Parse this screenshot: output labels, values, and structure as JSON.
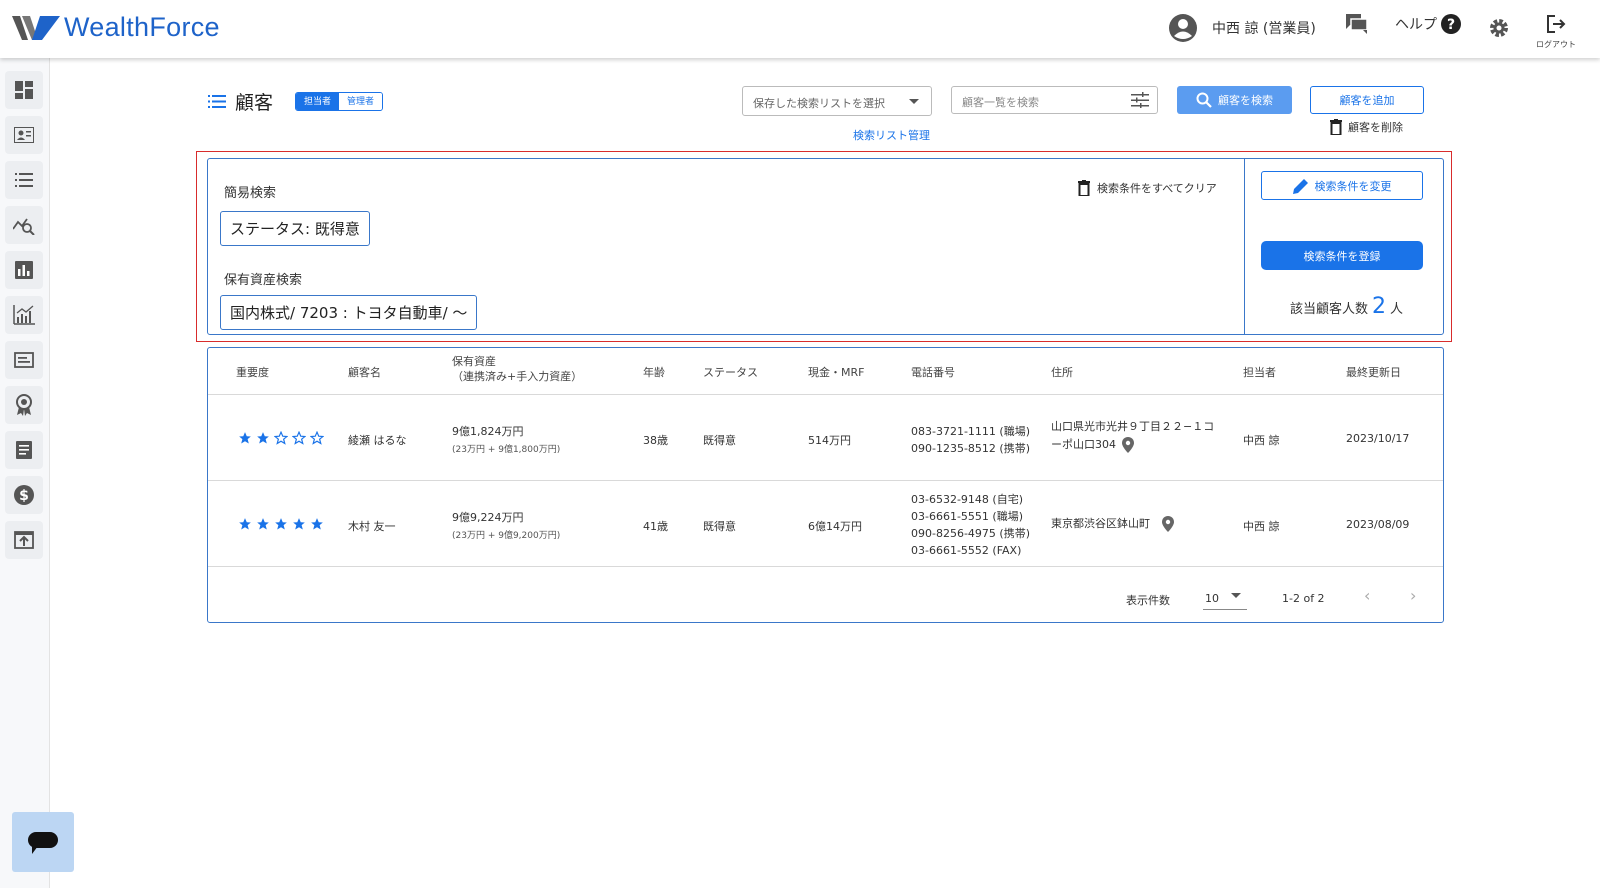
{
  "app": {
    "brand": "WealthForce"
  },
  "header": {
    "user_name": "中西 諒 (営業員)",
    "help_label": "ヘルプ",
    "logout_label": "ログアウト"
  },
  "sidebar": {
    "items": [
      {
        "icon": "dashboard-icon"
      },
      {
        "icon": "contact-card-icon"
      },
      {
        "icon": "list-icon"
      },
      {
        "icon": "analytics-search-icon"
      },
      {
        "icon": "bar-chart-icon"
      },
      {
        "icon": "chart-growth-icon"
      },
      {
        "icon": "card-icon"
      },
      {
        "icon": "award-icon"
      },
      {
        "icon": "document-icon"
      },
      {
        "icon": "dollar-icon"
      },
      {
        "icon": "upload-icon"
      }
    ]
  },
  "page": {
    "title": "顧客",
    "role_tabs": [
      "担当者",
      "管理者"
    ],
    "saved_list_placeholder": "保存した検索リストを選択",
    "saved_list_manage": "検索リスト管理",
    "search_placeholder": "顧客一覧を検索",
    "search_button": "顧客を検索",
    "add_button": "顧客を追加",
    "delete_button": "顧客を削除"
  },
  "search_panel": {
    "simple_label": "簡易検索",
    "status_chip": "ステータス: 既得意",
    "asset_label": "保有資産検索",
    "asset_chip": "国内株式/ 7203 : トヨタ自動車/ 〜",
    "clear_all": "検索条件をすべてクリア",
    "edit_button": "検索条件を変更",
    "register_button": "検索条件を登録",
    "count_label": "該当顧客人数",
    "count_value": "2",
    "count_unit": "人"
  },
  "table": {
    "headers": {
      "importance": "重要度",
      "name": "顧客名",
      "assets": "保有資産",
      "assets_sub": "（連携済み+手入力資産）",
      "age": "年齢",
      "status": "ステータス",
      "cash": "現金・MRF",
      "phone": "電話番号",
      "address": "住所",
      "owner": "担当者",
      "updated": "最終更新日"
    },
    "rows": [
      {
        "stars": 2,
        "name": "綾瀬 はるな",
        "assets": "9億1,824万円",
        "assets_sub": "(23万円 + 9億1,800万円)",
        "age": "38歳",
        "status": "既得意",
        "cash": "514万円",
        "phone1": "083-3721-1111 (職場)",
        "phone2": "090-1235-8512 (携帯)",
        "address1": "山口県光市光井９丁目２２−１コ",
        "address2": "ーポ山口304",
        "owner": "中西 諒",
        "updated": "2023/10/17"
      },
      {
        "stars": 5,
        "name": "木村 友一",
        "assets": "9億9,224万円",
        "assets_sub": "(23万円 + 9億9,200万円)",
        "age": "41歳",
        "status": "既得意",
        "cash": "6億14万円",
        "phone1": "03-6532-9148 (自宅)",
        "phone2": "03-6661-5551 (職場)",
        "phone3": "090-8256-4975 (携帯)",
        "phone4": "03-6661-5552 (FAX)",
        "address1": "東京都渋谷区鉢山町",
        "owner": "中西 諒",
        "updated": "2023/08/09"
      }
    ],
    "pager": {
      "per_page_label": "表示件数",
      "per_page_value": "10",
      "range": "1-2 of 2"
    }
  },
  "colors": {
    "accent": "#1a73e8",
    "highlight_border": "#d82c2c",
    "star": "#1a73e8"
  }
}
